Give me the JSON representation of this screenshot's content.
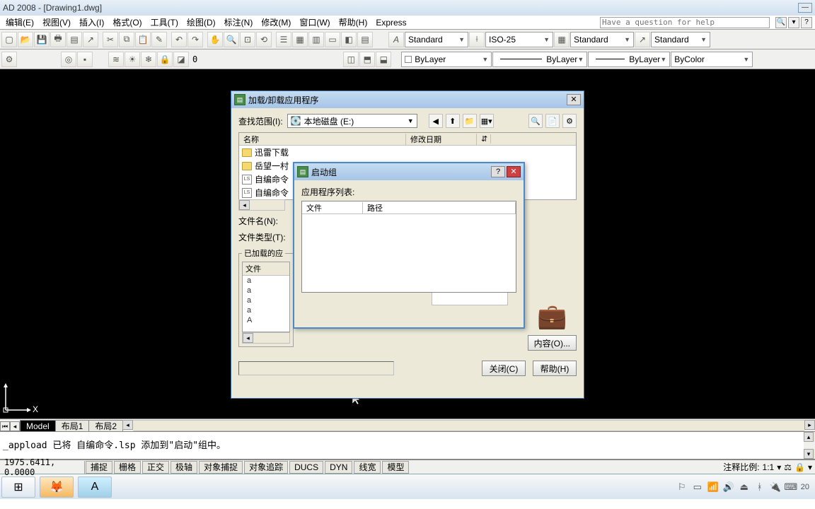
{
  "title": "AD 2008 - [Drawing1.dwg]",
  "menu": {
    "edit": "编辑(E)",
    "view": "视图(V)",
    "insert": "插入(I)",
    "format": "格式(O)",
    "tools": "工具(T)",
    "draw": "绘图(D)",
    "dim": "标注(N)",
    "modify": "修改(M)",
    "window": "窗口(W)",
    "help": "帮助(H)",
    "express": "Express"
  },
  "help_placeholder": "Have a question for help",
  "styles": {
    "text": "Standard",
    "dim": "ISO-25",
    "table": "Standard",
    "multi": "Standard"
  },
  "layerbar": {
    "layer": "ByLayer",
    "ltype": "ByLayer",
    "lweight": "ByLayer",
    "color": "ByColor",
    "zero": "0"
  },
  "dlg_load": {
    "title": "加载/卸载应用程序",
    "lookin_label": "查找范围(I):",
    "lookin_value": "本地磁盘 (E:)",
    "col_name": "名称",
    "col_date": "修改日期",
    "col_typ": "⇵",
    "files": [
      "迅雷下载",
      "岳望一村",
      "自编命令",
      "自编命令"
    ],
    "filename_label": "文件名(N):",
    "filetype_label": "文件类型(T):",
    "loaded_label": "已加载的应",
    "loaded_col": "文件",
    "loaded_items": [
      "a",
      "a",
      "a",
      "a",
      "A"
    ],
    "content_btn": "内容(O)...",
    "close_btn": "关闭(C)",
    "help_btn": "帮助(H)"
  },
  "dlg_startup": {
    "title": "启动组",
    "list_label": "应用程序列表:",
    "col_file": "文件",
    "col_path": "路径"
  },
  "tabs": {
    "model": "Model",
    "layout1": "布局1",
    "layout2": "布局2"
  },
  "cmdline": "_appload 已将 自编命令.lsp 添加到\"启动\"组中。",
  "coords": "1975.6411, 0.0000",
  "status_btns": {
    "snap": "捕捉",
    "grid": "栅格",
    "ortho": "正交",
    "polar": "极轴",
    "osnap": "对象捕捉",
    "otrack": "对象追踪",
    "ducs": "DUCS",
    "dyn": "DYN",
    "lwt": "线宽",
    "model": "模型"
  },
  "annoscale_label": "注释比例:",
  "annoscale_value": "1:1",
  "ucs": {
    "x": "X"
  },
  "tray_time": "20"
}
